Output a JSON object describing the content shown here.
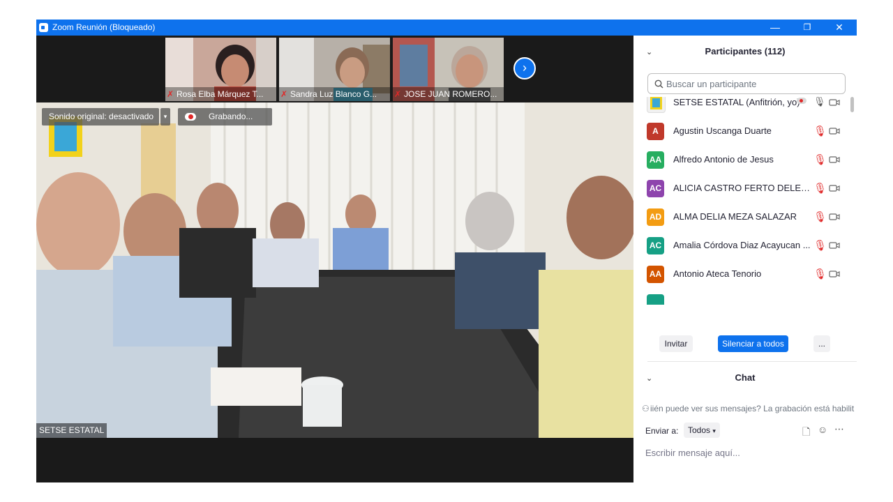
{
  "window": {
    "title": "Zoom Reunión (Bloqueado)",
    "minimize_glyph": "—",
    "maximize_glyph": "❐",
    "close_glyph": "✕"
  },
  "thumbnails": [
    {
      "name": "Rosa Elba Márquez T...",
      "muted": true
    },
    {
      "name": "Sandra Luz Blanco G...",
      "muted": true
    },
    {
      "name": "JOSE JUAN ROMERO...",
      "muted": true
    }
  ],
  "main_video": {
    "original_sound_label": "Sonido original: desactivado",
    "recording_label": "Grabando...",
    "speaker_name": "SETSE ESTATAL"
  },
  "participants": {
    "header": "Participantes (112)",
    "search_placeholder": "Buscar un participante",
    "list": [
      {
        "initials": "",
        "name": "SETSE ESTATAL (Anfitrión, yo)",
        "color": "#f1f1f1",
        "is_logo": true,
        "muted": false
      },
      {
        "initials": "A",
        "name": "Agustin Uscanga Duarte",
        "color": "#c0392b",
        "is_logo": false,
        "muted": true
      },
      {
        "initials": "AA",
        "name": "Alfredo Antonio de Jesus",
        "color": "#27ae60",
        "is_logo": false,
        "muted": true
      },
      {
        "initials": "AC",
        "name": "ALICIA CASTRO FERTO DELEGAC...",
        "color": "#8e44ad",
        "is_logo": false,
        "muted": true
      },
      {
        "initials": "AD",
        "name": "ALMA DELIA MEZA SALAZAR",
        "color": "#f39c12",
        "is_logo": false,
        "muted": true
      },
      {
        "initials": "AC",
        "name": "Amalia Córdova Diaz Acayucan ...",
        "color": "#16a085",
        "is_logo": false,
        "muted": true
      },
      {
        "initials": "AA",
        "name": "Antonio Ateca Tenorio",
        "color": "#d35400",
        "is_logo": false,
        "muted": true
      }
    ],
    "invite_label": "Invitar",
    "mute_all_label": "Silenciar a todos",
    "more_label": "..."
  },
  "chat": {
    "header": "Chat",
    "info_text": "iién puede ver sus mensajes? La grabación está habilit",
    "send_to_label": "Enviar a:",
    "send_to_value": "Todos",
    "input_placeholder": "Escribir mensaje aquí..."
  },
  "colors": {
    "titlebar": "#0e72ed",
    "accent_blue": "#0e72ed",
    "muted_red": "#e02828"
  }
}
